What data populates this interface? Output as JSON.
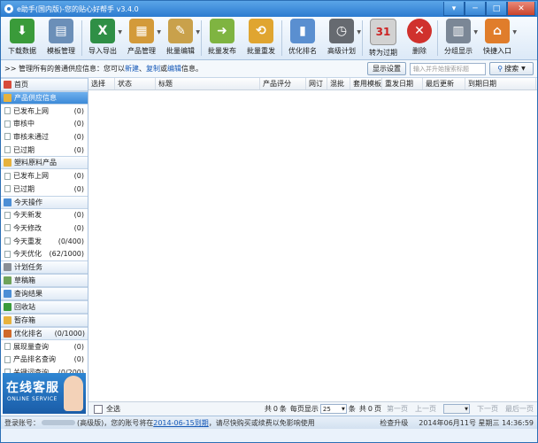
{
  "window": {
    "title": "e助手(国内版)-您的贴心好帮手 v3.4.0",
    "controls": {
      "menu": "▾",
      "minimize": "─",
      "maximize": "□",
      "close": "✕"
    }
  },
  "toolbar": [
    {
      "name": "download-data",
      "label": "下载数据",
      "icon": "download-icon",
      "color": "#3a9b3a",
      "glyph": "⬇"
    },
    {
      "name": "template-manage",
      "label": "模板管理",
      "icon": "template-icon",
      "color": "#6b8fb8",
      "glyph": "▤"
    },
    {
      "name": "import-export",
      "label": "导入导出",
      "icon": "excel-icon",
      "color": "#2f8f46",
      "glyph": "X",
      "dropdown": true
    },
    {
      "name": "product-manage",
      "label": "产品管理",
      "icon": "product-icon",
      "color": "#d39a3a",
      "glyph": "▦",
      "dropdown": true
    },
    {
      "name": "batch-edit",
      "label": "批量编辑",
      "icon": "edit-icon",
      "color": "#c9a14b",
      "glyph": "✎",
      "dropdown": true
    },
    {
      "name": "batch-publish",
      "label": "批量发布",
      "icon": "publish-icon",
      "color": "#7fb441",
      "glyph": "➜"
    },
    {
      "name": "batch-repost",
      "label": "批量重发",
      "icon": "repost-icon",
      "color": "#e0a530",
      "glyph": "⟲"
    },
    {
      "name": "optimize-rank",
      "label": "优化排名",
      "icon": "rank-chart-icon",
      "color": "#5a8fd0",
      "glyph": "▮"
    },
    {
      "name": "advanced-plan",
      "label": "高级计划",
      "icon": "clock-icon",
      "color": "#666a70",
      "glyph": "◷",
      "dropdown": true
    },
    {
      "name": "convert-expired",
      "label": "转为过期",
      "icon": "calendar-icon",
      "color": "#d2d2d2",
      "glyph": "31"
    },
    {
      "name": "delete",
      "label": "删除",
      "icon": "delete-icon",
      "color": "#d0312d",
      "glyph": "✕"
    },
    {
      "name": "group-display",
      "label": "分组显示",
      "icon": "group-icon",
      "color": "#7b8796",
      "glyph": "▥",
      "dropdown": true
    },
    {
      "name": "quick-entry",
      "label": "快捷入口",
      "icon": "house-icon",
      "color": "#e07d2b",
      "glyph": "⌂",
      "dropdown": true
    }
  ],
  "infobar": {
    "prefix": ">>",
    "text1": "管理所有的普通供应信息：您可以",
    "link_new": "新建",
    "sep1": "、",
    "link_copy": "复制",
    "mid": "或",
    "link_edit": "编辑",
    "text2": "信息。",
    "show_settings": "显示设置",
    "search_placeholder": "输入并升始搜索标题",
    "search_button": "搜索"
  },
  "sidebar": {
    "home": "首页",
    "groups": [
      {
        "name": "product-supply",
        "label": "产品供应信息",
        "selected": true,
        "items": [
          {
            "label": "已发布上网",
            "count": "(0)"
          },
          {
            "label": "审核中",
            "count": "(0)"
          },
          {
            "label": "审核未通过",
            "count": "(0)"
          },
          {
            "label": "已过期",
            "count": "(0)"
          }
        ]
      },
      {
        "name": "plastic-raw",
        "label": "塑料原料产品",
        "items": [
          {
            "label": "已发布上网",
            "count": "(0)"
          },
          {
            "label": "已过期",
            "count": "(0)"
          }
        ]
      },
      {
        "name": "today-ops",
        "label": "今天操作",
        "items": [
          {
            "label": "今天新发",
            "count": "(0)"
          },
          {
            "label": "今天修改",
            "count": "(0)"
          },
          {
            "label": "今天重发",
            "count": "(0/400)"
          },
          {
            "label": "今天优化",
            "count": "(62/1000)"
          }
        ]
      },
      {
        "name": "plan-tasks",
        "label": "计划任务",
        "items": []
      },
      {
        "name": "drafts",
        "label": "草稿箱",
        "items": []
      },
      {
        "name": "query-results",
        "label": "查询结果",
        "items": []
      },
      {
        "name": "recycle-bin",
        "label": "回收站",
        "items": []
      },
      {
        "name": "temp-box",
        "label": "暂存箱",
        "items": []
      },
      {
        "name": "optimize-rank",
        "label": "优化排名",
        "count": "(0/1000)",
        "items": [
          {
            "label": "展现量查询",
            "count": "(0)"
          },
          {
            "label": "产品排名查询",
            "count": "(0)"
          },
          {
            "label": "关键词查询",
            "count": "(0/200)"
          }
        ]
      }
    ],
    "service_big": "在线客服",
    "service_small": "ONLINE SERVICE"
  },
  "table": {
    "columns": [
      "选择",
      "状态",
      "标题",
      "产品评分",
      "网订",
      "混批",
      "套用模板",
      "重发日期",
      "最后更新",
      "到期日期"
    ]
  },
  "pager": {
    "select_all": "全选",
    "total_prefix": "共",
    "total_count": "0",
    "total_suffix": "条",
    "per_page_label": "每页显示",
    "per_page_value": "25",
    "per_page_suffix": "条",
    "pages_prefix": "共",
    "pages_count": "0",
    "pages_suffix": "页",
    "first": "第一页",
    "prev": "上一页",
    "next": "下一页",
    "last": "最后一页"
  },
  "status": {
    "account_label": "登录账号：",
    "account_level": "(高级版)，您的账号将在",
    "expire_date": "2014-06-15到期",
    "expire_tail": "，请尽快购买或续费以免影响使用",
    "upgrade": "检查升级",
    "datetime": "2014年06月11号 星期三 14:36:59"
  }
}
